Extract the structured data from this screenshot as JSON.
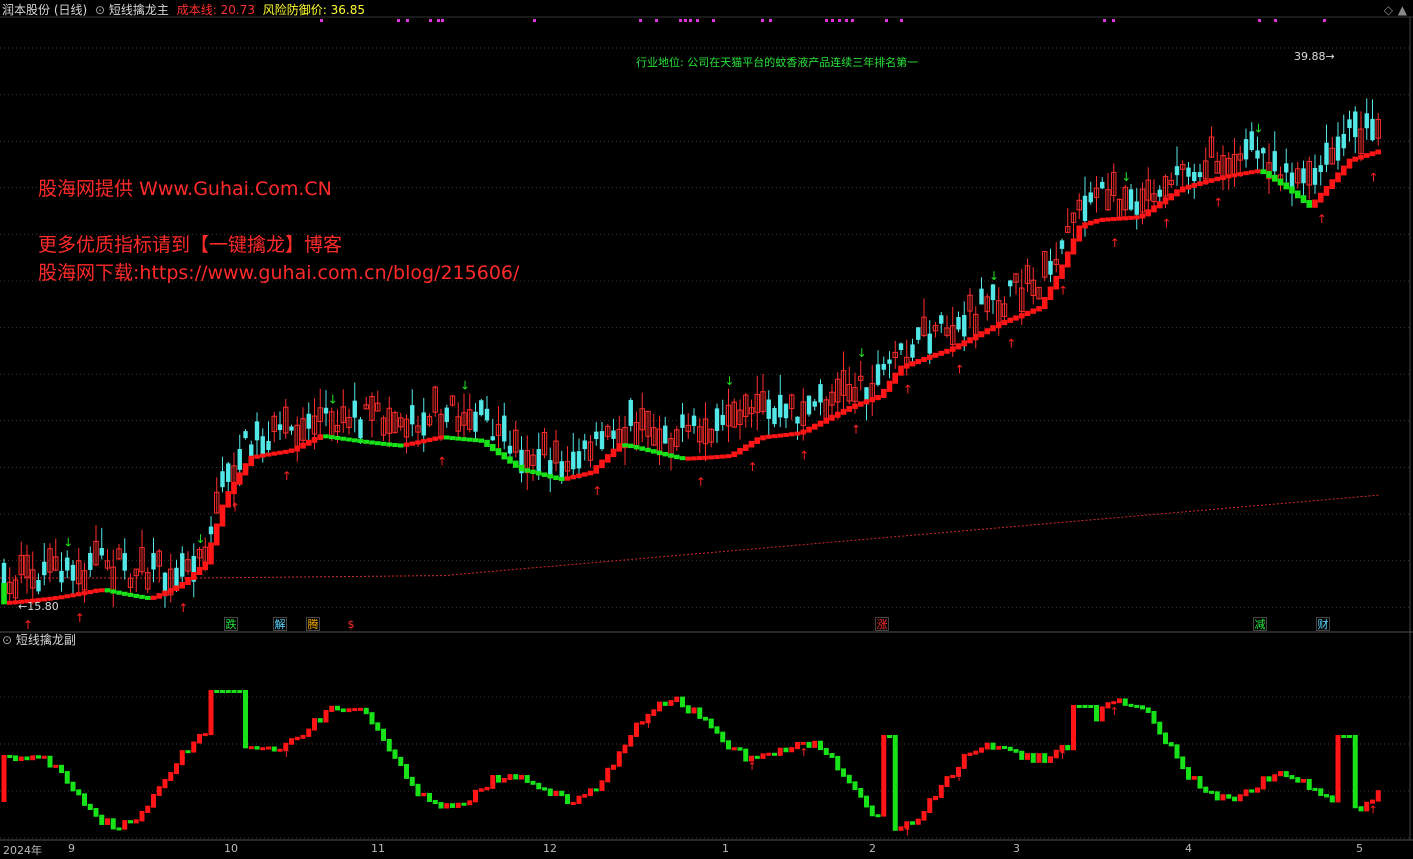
{
  "header": {
    "stock": "润本股份 (日线)",
    "indicator": "短线擒龙主",
    "cost_label": "成本线: ",
    "cost_value": "20.73",
    "risk_label": "风险防御价: ",
    "risk_value": "36.85"
  },
  "sub_panel": {
    "title": "短线擒龙副"
  },
  "watermark": {
    "line1": "股海网提供 Www.Guhai.Com.CN",
    "line2": "更多优质指标请到【一键擒龙】博客",
    "line3": "股海网下载:https://www.guhai.com.cn/blog/215606/"
  },
  "annotation": "行业地位: 公司在天猫平台的蚊香液产品连续三年排名第一",
  "price_marks": {
    "high": "39.88",
    "low": "15.80"
  },
  "event_tags": [
    {
      "label": "跌",
      "color": "#26e63c"
    },
    {
      "label": "解",
      "color": "#5ad8ff"
    },
    {
      "label": "腾",
      "color": "#ffb000"
    },
    {
      "label": "$",
      "color": "#ff3030"
    },
    {
      "label": "涨",
      "color": "#ff3030"
    },
    {
      "label": "减",
      "color": "#26e63c"
    },
    {
      "label": "财",
      "color": "#5ad8ff"
    }
  ],
  "x_axis": [
    "2024年",
    "9",
    "10",
    "11",
    "12",
    "1",
    "2",
    "3",
    "4",
    "5"
  ],
  "colors": {
    "up": "#ff2d2d",
    "down": "#53e8e8",
    "support_up": "#ff1515",
    "support_down": "#18e318",
    "cost_line": "#d22a2a",
    "buy": "#ff2020",
    "sell": "#20e020"
  }
}
